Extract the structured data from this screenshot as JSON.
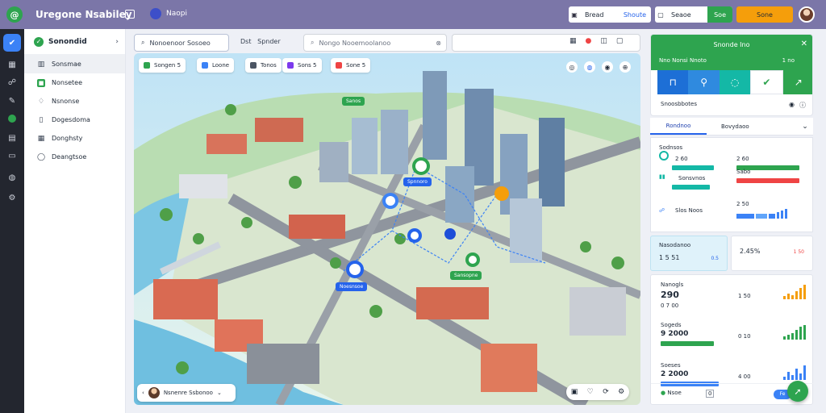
{
  "app": {
    "title": "Uregone Nsabiley",
    "user": "Naopi"
  },
  "topbar": {
    "btn1_label": "Bread",
    "btn1_value": "Shoute",
    "btn2_label": "Seaoe",
    "btn2_action": "Soe",
    "btn3_label": "Sone"
  },
  "sidebar": {
    "header": "Sonondid",
    "items": [
      {
        "label": "Sonsmae",
        "icon": "map-icon"
      },
      {
        "label": "Nonsetee",
        "icon": "green-square-icon"
      },
      {
        "label": "Nsnonse",
        "icon": "bell-icon"
      },
      {
        "label": "Dogesdoma",
        "icon": "doc-icon"
      },
      {
        "label": "Donghsty",
        "icon": "grid-icon"
      },
      {
        "label": "Deangtsoe",
        "icon": "circle-icon"
      }
    ]
  },
  "mapbar": {
    "search1": "Nonoenoor Sosoeo",
    "filter": "Dst",
    "filter_value": "Spnder",
    "search2_placeholder": "Nongo Nooemoolanoo"
  },
  "map_chips": [
    {
      "label": "Songen 5",
      "color": "#2ea44f"
    },
    {
      "label": "Loone",
      "color": "#3b82f6"
    },
    {
      "label": "Tonos",
      "color": "#4b5563"
    },
    {
      "label": "Sons 5",
      "color": "#7c3aed"
    },
    {
      "label": "Sone 5",
      "color": "#ef4444"
    }
  ],
  "map_pins": [
    {
      "label": "Sanos",
      "color": "#2ea44f"
    },
    {
      "label": "Spnnoro",
      "color": "#2563eb"
    },
    {
      "label": "Noesnsoe",
      "color": "#2563eb"
    },
    {
      "label": "Sansopne",
      "color": "#2ea44f"
    }
  ],
  "map_popup": {
    "label": "Nsnenre Ssbonoo"
  },
  "panel": {
    "header_title": "Snonde Ino",
    "header_left": "Nno Nonsi Nnoto",
    "header_right": "1 no",
    "subtitle": "Snoosbbotes",
    "tab_active": "Rondnoo",
    "tab_other": "Bovydaoo",
    "metrics": [
      {
        "label": "Sodnsos",
        "left_value": "2 60",
        "right_value": "2 60",
        "left_color": "#14b8a6",
        "right_color": "#2ea44f",
        "left_fill": 0.72,
        "right_fill": 0.95
      },
      {
        "label": "Sonsvnos",
        "left_value": "",
        "right_value": "Sabo",
        "left_color": "#14b8a6",
        "right_color": "#ef4444",
        "left_fill": 0.65,
        "right_fill": 0.95
      },
      {
        "label": "Slos Noos",
        "left_value": "",
        "right_value": "2 50",
        "left_color": "#60a5fa",
        "right_color": "#3b82f6",
        "left_fill": 0.0,
        "right_fill": 0.95
      }
    ],
    "stat1": {
      "title": "Nasodanoo",
      "value": "1 5 51",
      "sub": "0.5"
    },
    "stat2": {
      "value": "2.45%",
      "sub": "1 50"
    },
    "trends": [
      {
        "label": "Nanogls",
        "value": "290",
        "right": "1 50",
        "right2": "0 7 00",
        "color": "#f59e0b",
        "spark": [
          4,
          7,
          5,
          10,
          14,
          18
        ]
      },
      {
        "label": "Sogeds",
        "value": "9 2000",
        "right": "0 10",
        "right2": "",
        "color": "#2ea44f",
        "spark": [
          4,
          6,
          8,
          12,
          16,
          18
        ]
      },
      {
        "label": "Soeses",
        "value": "2 2000",
        "right": "4 00",
        "right2": "",
        "color": "#3b82f6",
        "spark": [
          4,
          10,
          6,
          14,
          8,
          18
        ]
      }
    ],
    "footer_label": "Nsoe",
    "footer_input": "0",
    "footer_toggle": "Fe"
  },
  "colors": {
    "brand": "#2ea44f",
    "topbar": "#7b76a8",
    "accent": "#3b82f6"
  }
}
